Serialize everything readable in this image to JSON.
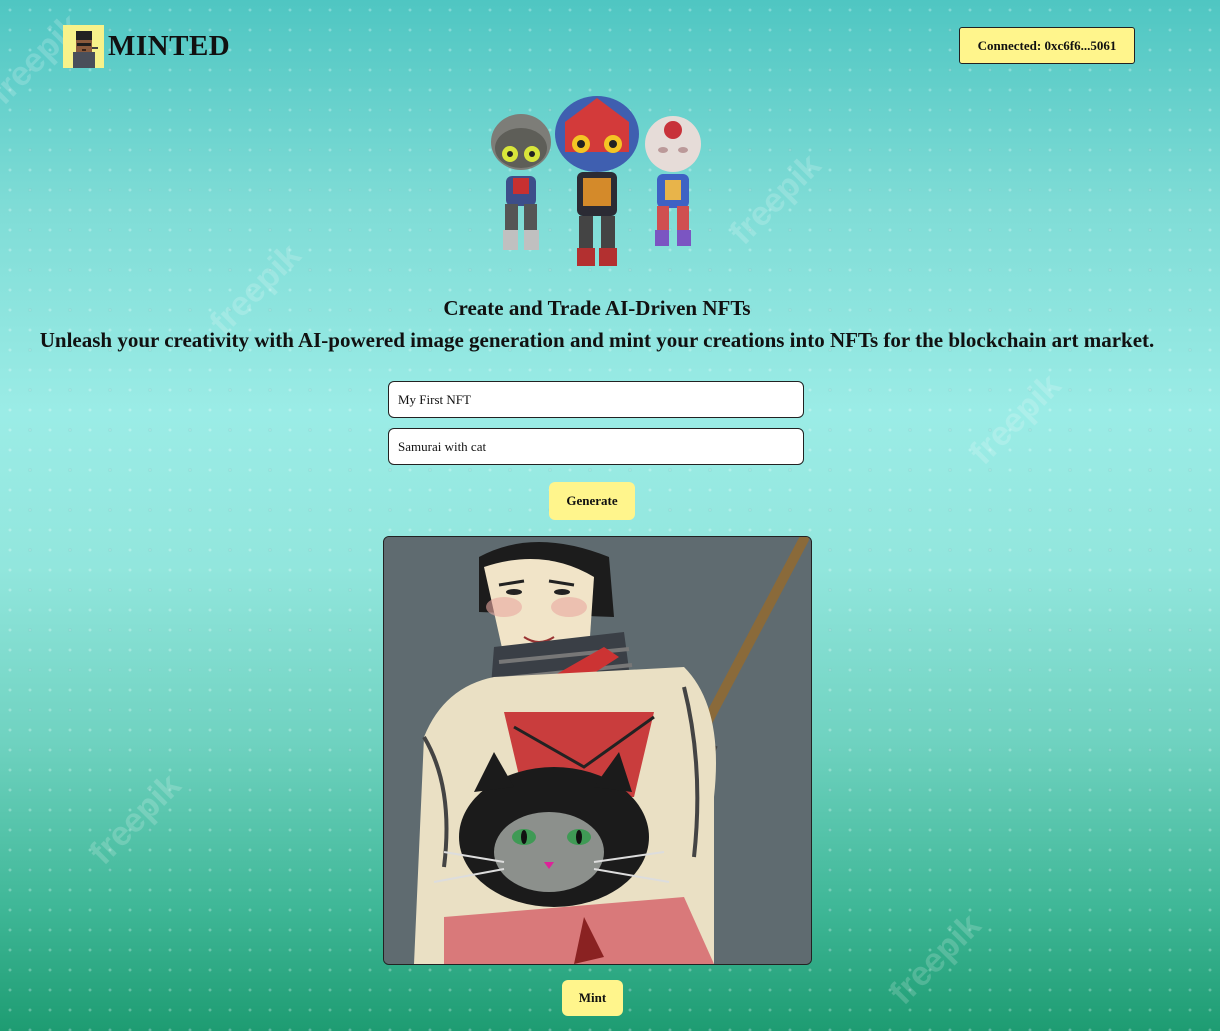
{
  "brand": {
    "logo_text": "MINTED"
  },
  "wallet": {
    "connected_label": "Connected: 0xc6f6...5061"
  },
  "hero": {
    "title": "Create and Trade AI-Driven NFTs",
    "subtitle": "Unleash your creativity with AI-powered image generation and mint your creations into NFTs for the blockchain art market."
  },
  "form": {
    "name_value": "My First NFT",
    "prompt_value": "Samurai with cat",
    "generate_label": "Generate"
  },
  "result": {
    "mint_label": "Mint"
  },
  "background": {
    "watermark_text": "freepik"
  },
  "colors": {
    "button_yellow": "#fff58c",
    "background_teal": "#9bece6"
  }
}
